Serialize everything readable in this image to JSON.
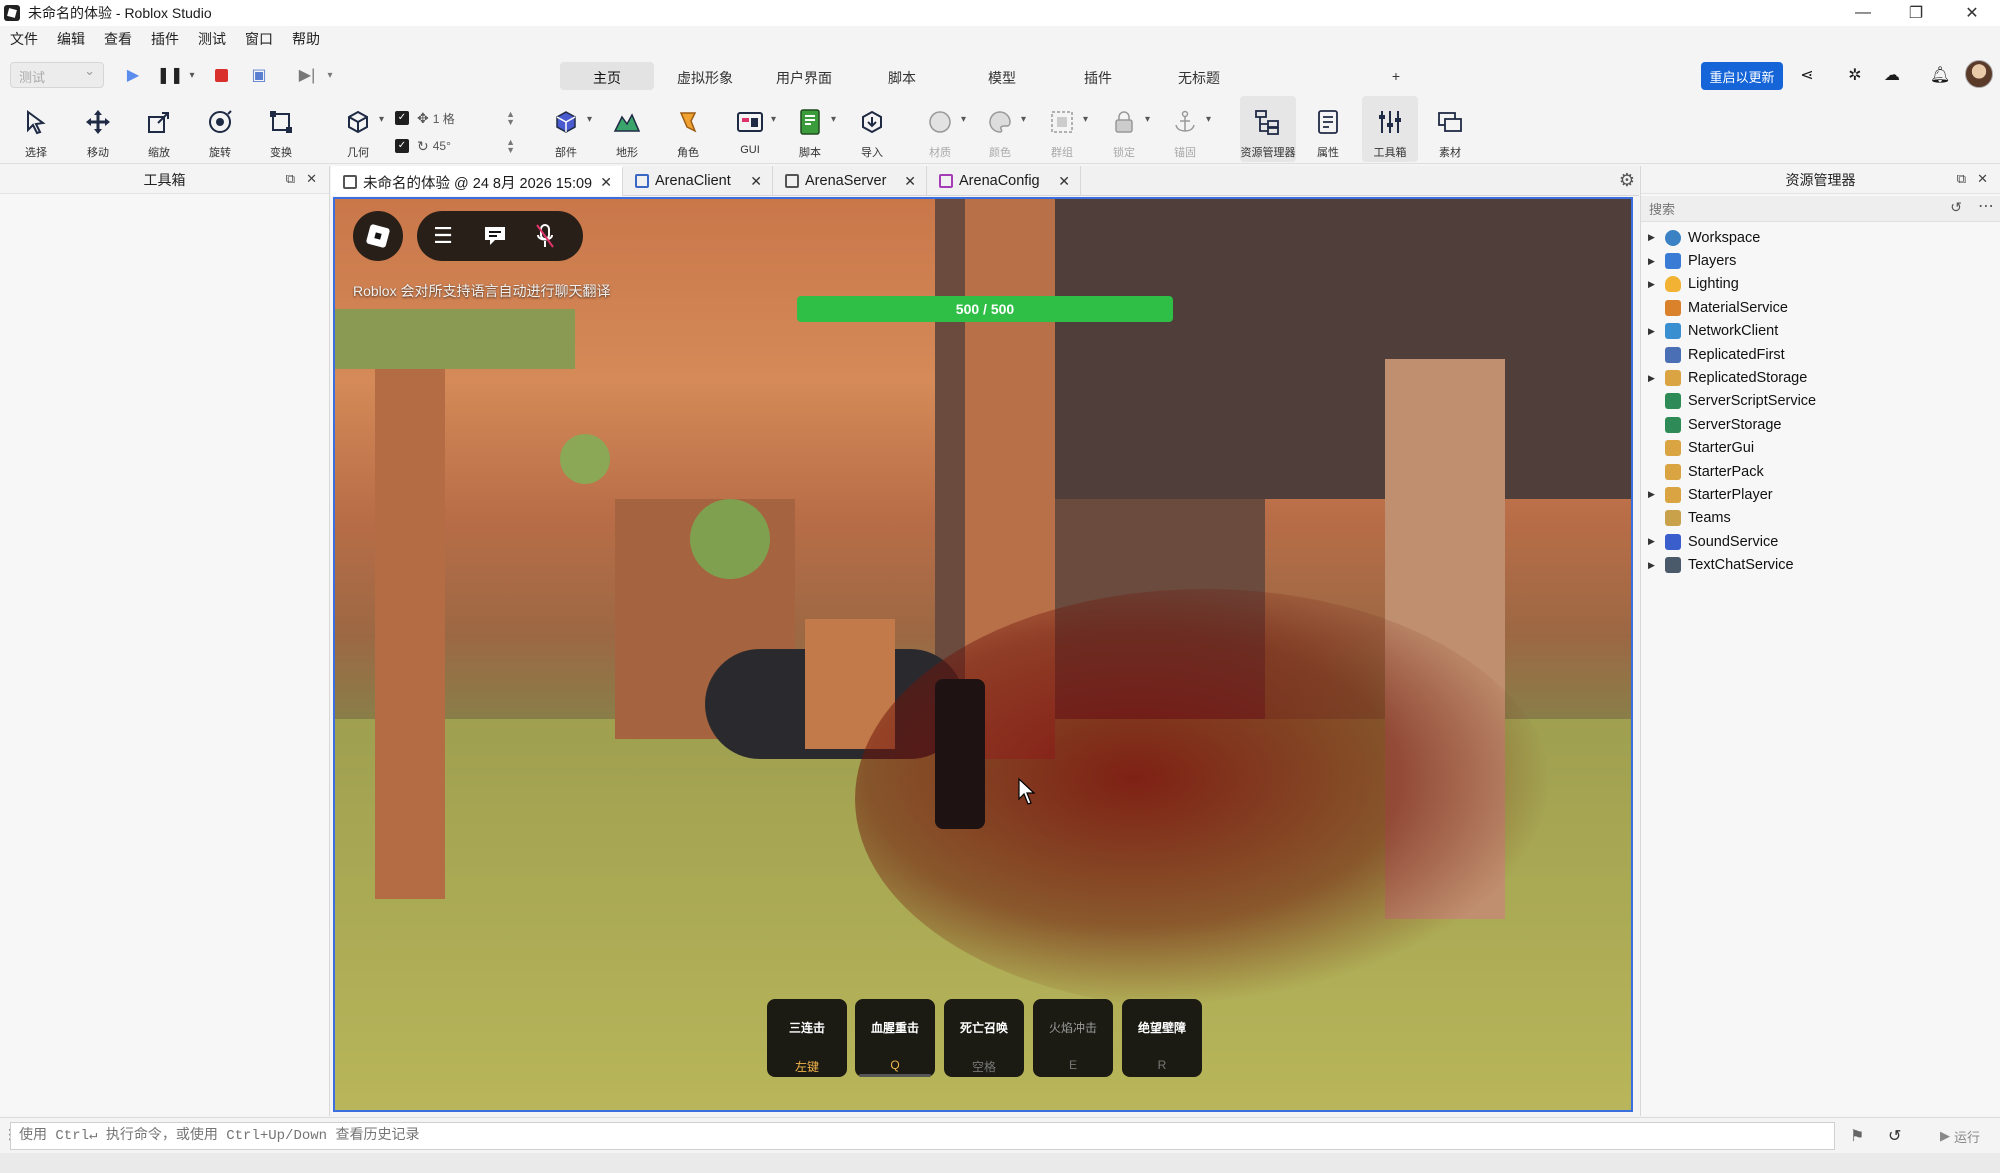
{
  "window": {
    "title": "未命名的体验 - Roblox Studio",
    "controls": [
      "—",
      "❐",
      "✕"
    ]
  },
  "menu": [
    "文件",
    "编辑",
    "查看",
    "插件",
    "测试",
    "窗口",
    "帮助"
  ],
  "ribbon": {
    "test_select": "测试",
    "tabs": [
      {
        "label": "主页",
        "active": true
      },
      {
        "label": "虚拟形象",
        "active": false
      },
      {
        "label": "用户界面",
        "active": false
      },
      {
        "label": "脚本",
        "active": false
      },
      {
        "label": "模型",
        "active": false
      },
      {
        "label": "插件",
        "active": false
      },
      {
        "label": "无标题",
        "active": false
      },
      {
        "label": "+",
        "active": false
      }
    ],
    "restart_label": "重启以更新"
  },
  "toolbar": {
    "tools": [
      {
        "label": "选择",
        "icon": "cursor-arrow-icon"
      },
      {
        "label": "移动",
        "icon": "move-arrows-icon"
      },
      {
        "label": "缩放",
        "icon": "scale-icon"
      },
      {
        "label": "旋转",
        "icon": "rotate-icon"
      },
      {
        "label": "变换",
        "icon": "transform-icon"
      },
      {
        "label": "几何",
        "icon": "geometry-icon"
      },
      {
        "label": "部件",
        "icon": "part-cube-icon"
      },
      {
        "label": "地形",
        "icon": "terrain-icon"
      },
      {
        "label": "角色",
        "icon": "character-icon"
      },
      {
        "label": "GUI",
        "icon": "gui-icon"
      },
      {
        "label": "脚本",
        "icon": "script-icon"
      },
      {
        "label": "导入",
        "icon": "import-icon"
      },
      {
        "label": "材质",
        "icon": "material-icon"
      },
      {
        "label": "颜色",
        "icon": "color-palette-icon"
      },
      {
        "label": "群组",
        "icon": "group-icon"
      },
      {
        "label": "锁定",
        "icon": "lock-icon"
      },
      {
        "label": "锚固",
        "icon": "anchor-icon"
      },
      {
        "label": "资源管理器",
        "icon": "explorer-icon"
      },
      {
        "label": "属性",
        "icon": "properties-icon"
      },
      {
        "label": "工具箱",
        "icon": "toolbox-icon"
      },
      {
        "label": "素材",
        "icon": "assets-icon"
      }
    ],
    "snap_move": "1 格",
    "snap_rotate": "45°"
  },
  "toolbox_panel": {
    "title": "工具箱"
  },
  "doc_tabs": [
    {
      "label": "未命名的体验 @ 24 8月 2026 15:09",
      "active": true
    },
    {
      "label": "ArenaClient",
      "active": false
    },
    {
      "label": "ArenaServer",
      "active": false
    },
    {
      "label": "ArenaConfig",
      "active": false
    }
  ],
  "game": {
    "chat_note": "Roblox 会对所支持语言自动进行聊天翻译",
    "health_text": "500 / 500",
    "skills": [
      {
        "name": "三连击",
        "key": "左键",
        "ready": true
      },
      {
        "name": "血腥重击",
        "key": "Q",
        "ready": true
      },
      {
        "name": "死亡召唤",
        "key": "空格",
        "ready": true
      },
      {
        "name": "火焰冲击",
        "key": "E",
        "ready": false
      },
      {
        "name": "绝望壁障",
        "key": "R",
        "ready": false
      }
    ]
  },
  "explorer": {
    "title": "资源管理器",
    "search_placeholder": "搜索",
    "items": [
      {
        "label": "Workspace",
        "expandable": true,
        "color": "#3b82c4"
      },
      {
        "label": "Players",
        "expandable": true,
        "color": "#3a7bd5"
      },
      {
        "label": "Lighting",
        "expandable": true,
        "color": "#f2b233"
      },
      {
        "label": "MaterialService",
        "expandable": false,
        "color": "#d9822b"
      },
      {
        "label": "NetworkClient",
        "expandable": true,
        "color": "#3a8fd0"
      },
      {
        "label": "ReplicatedFirst",
        "expandable": false,
        "color": "#4a6fb5"
      },
      {
        "label": "ReplicatedStorage",
        "expandable": true,
        "color": "#d9a441"
      },
      {
        "label": "ServerScriptService",
        "expandable": false,
        "color": "#2e8b57"
      },
      {
        "label": "ServerStorage",
        "expandable": false,
        "color": "#2e8b57"
      },
      {
        "label": "StarterGui",
        "expandable": false,
        "color": "#d9a441"
      },
      {
        "label": "StarterPack",
        "expandable": false,
        "color": "#d9a441"
      },
      {
        "label": "StarterPlayer",
        "expandable": true,
        "color": "#d9a441"
      },
      {
        "label": "Teams",
        "expandable": false,
        "color": "#c9a14a"
      },
      {
        "label": "SoundService",
        "expandable": true,
        "color": "#3a5fcd"
      },
      {
        "label": "TextChatService",
        "expandable": true,
        "color": "#4a5a6a"
      }
    ]
  },
  "command_bar": {
    "placeholder": "使用 Ctrl↵ 执行命令，或使用 Ctrl+Up/Down 查看历史记录",
    "run_label": "运行"
  },
  "colors": {
    "accent": "#1565d8",
    "viewport_border": "#3b6fe0",
    "health_bar": "#2fbe46"
  }
}
